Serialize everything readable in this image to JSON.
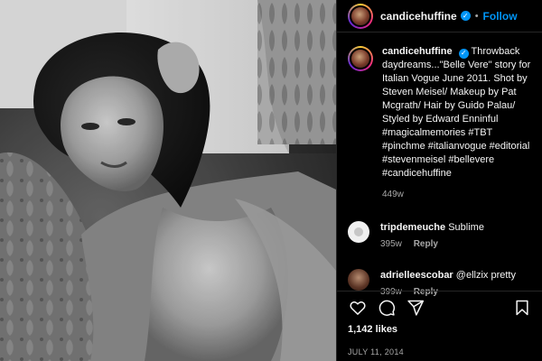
{
  "post_author": {
    "username": "candicehuffine",
    "verified": true,
    "follow_label": "Follow",
    "separator": "•"
  },
  "photo": {
    "description": "black-and-white editorial photograph of a woman reclining against a patterned cushion"
  },
  "caption": {
    "username": "candicehuffine",
    "text": "Throwback daydreams...\"Belle Vere\" story for Italian Vogue June 2011. Shot by Steven Meisel/ Makeup by Pat Mcgrath/ Hair by Guido Palau/ Styled by Edward Enninful #magicalmemories #TBT #pinchme #italianvogue #editorial #stevenmeisel #bellevere #candicehuffine",
    "time": "449w"
  },
  "comments": [
    {
      "username": "tripdemeuche",
      "text": "Sublime",
      "time": "395w",
      "reply_label": "Reply",
      "avatar": "default-avatar"
    },
    {
      "username": "adrielleescobar",
      "text": "@ellzix pretty",
      "time": "399w",
      "reply_label": "Reply",
      "avatar": "photo-avatar"
    }
  ],
  "actions": {
    "icons": [
      "heart-icon",
      "comment-icon",
      "share-icon",
      "bookmark-icon"
    ],
    "likes": "1,142 likes",
    "date": "JULY 11, 2014"
  },
  "colors": {
    "background": "#000000",
    "text": "#f5f5f5",
    "muted": "#a8a8a8",
    "accent": "#0095f6",
    "divider": "#262626"
  }
}
